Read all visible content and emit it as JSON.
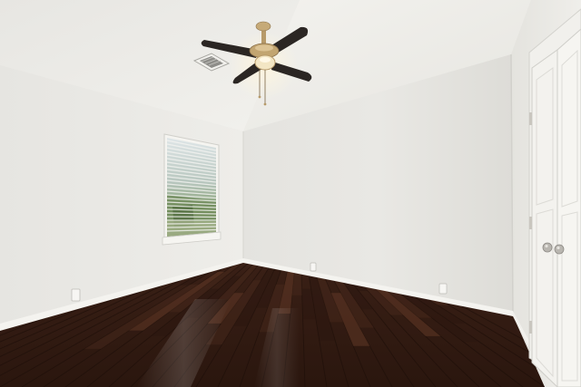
{
  "scene": {
    "kind": "photo",
    "subject": "empty-bedroom",
    "elements": [
      "vaulted-ceiling",
      "ceiling-fan",
      "air-vent",
      "window-with-blinds",
      "double-closet-door",
      "hardwood-floor",
      "baseboards",
      "wall-outlets"
    ]
  },
  "colors": {
    "ceiling": "#efeeea",
    "wall_left": "#e9e8e4",
    "wall_back": "#e2e1dc",
    "wall_right": "#ecebe7",
    "baseboard": "#f4f3ef",
    "floor_dark": "#2a1710",
    "floor_mid": "#4a2a1c",
    "floor_light": "#6b3f2a",
    "fan_blade": "#2b2623",
    "fan_brass": "#b79a6a",
    "window_green": "#6f8a5a",
    "door": "#f3f2ee",
    "door_knob": "#b9b6b0"
  }
}
